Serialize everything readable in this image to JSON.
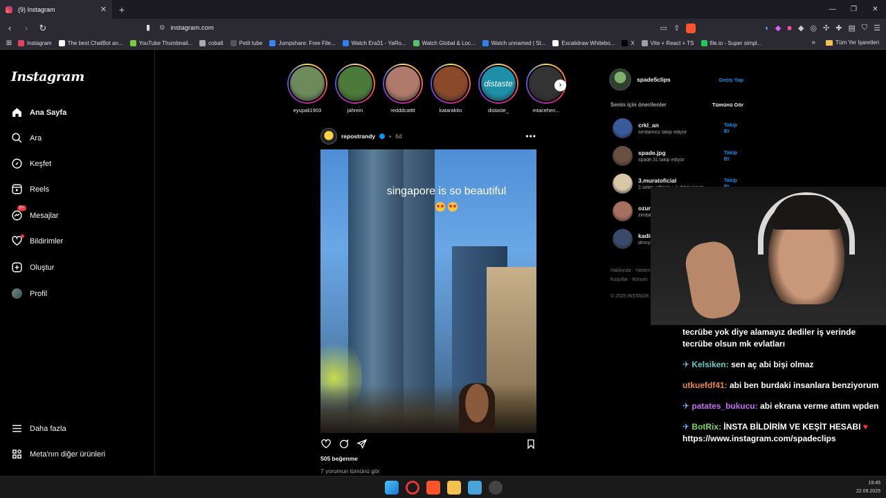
{
  "browser": {
    "tab_title": "(9) Instagram",
    "url": "instagram.com",
    "bookmarks": [
      {
        "label": "Instagram",
        "color": "#e4405f"
      },
      {
        "label": "The best ChatBot an...",
        "color": "#ffffff"
      },
      {
        "label": "YouTube Thumbnail...",
        "color": "#7ac943"
      },
      {
        "label": "cobalt",
        "color": "#aaaaaa"
      },
      {
        "label": "Petit tube",
        "color": "#555555"
      },
      {
        "label": "Jumpshare: Free File...",
        "color": "#3b82f6"
      },
      {
        "label": "Watch Era31 - YaRo...",
        "color": "#2f80ed"
      },
      {
        "label": "Watch Global & Loc...",
        "color": "#56c271"
      },
      {
        "label": "Watch unnamed | St...",
        "color": "#2f80ed"
      },
      {
        "label": "Excalidraw Whitebo...",
        "color": "#ffffff"
      },
      {
        "label": "X",
        "color": "#000000"
      },
      {
        "label": "Vite + React + TS",
        "color": "#9aa0a6"
      },
      {
        "label": "file.io - Super simpl...",
        "color": "#22c55e"
      }
    ],
    "bookmarks_all": "Tüm Yer İşaretleri"
  },
  "sidebar": {
    "logo": "Instagram",
    "items": [
      {
        "label": "Ana Sayfa",
        "icon": "home-icon"
      },
      {
        "label": "Ara",
        "icon": "search-icon"
      },
      {
        "label": "Keşfet",
        "icon": "compass-icon"
      },
      {
        "label": "Reels",
        "icon": "reels-icon"
      },
      {
        "label": "Mesajlar",
        "icon": "messenger-icon",
        "badge": "9+"
      },
      {
        "label": "Bildirimler",
        "icon": "heart-icon"
      },
      {
        "label": "Oluştur",
        "icon": "plus-icon"
      },
      {
        "label": "Profil",
        "icon": "avatar"
      }
    ],
    "more": "Daha fazla",
    "meta": "Meta'nın diğer ürünleri"
  },
  "stories": [
    {
      "name": "eyupali1903",
      "color": "#6d8a5a"
    },
    {
      "name": "jahrein",
      "color": "#4c7a3a"
    },
    {
      "name": "redddcatttt",
      "color": "#b07a6a"
    },
    {
      "name": "katarakito",
      "color": "#8a4a2a"
    },
    {
      "name": "distaste_",
      "color": "#1e8fa8",
      "text": "distaste"
    },
    {
      "name": "mtacehen...",
      "color": "#333333"
    }
  ],
  "post": {
    "username": "repostrandy",
    "time": "6d",
    "overlay_text": "singapore is so beautiful",
    "likes": "505 beğenme",
    "comments_link": "7 yorumun tümünü gör"
  },
  "right": {
    "me_username": "spade5clips",
    "switch": "Geçiş Yap",
    "suggestions_title": "Senin için önerilenler",
    "see_all": "Tümünü Gör",
    "follow_label": "Takip Et",
    "suggestions": [
      {
        "user": "crkl_an",
        "sub": "serdarincc takip ediyor",
        "color": "#3a5a9a"
      },
      {
        "user": "spade.jpg",
        "sub": "spade.31 takip ediyor",
        "color": "#6a5040"
      },
      {
        "user": "3.muratoficial",
        "sub": "2.selim_official + 1 diğer kişi ta...",
        "color": "#d8c8a8"
      },
      {
        "user": "ozurlukedi17",
        "sub": "zimbabwelifatih takip ediyor",
        "color": "#a87060"
      },
      {
        "user": "kadirlcnn",
        "sub": "dmnysnn takip ediyor",
        "color": "#3a4a6a"
      }
    ],
    "footer_line1": "Hakkında · Yardım · ... · API · İş Fı...",
    "footer_line2": "Koşullar · Konum · ... · eta Ver...",
    "footer_line3": "© 2025 INSTAGR..."
  },
  "chat": {
    "messages": [
      {
        "user": "",
        "text": "tecrübe yok diye alamayız dediler iş verinde tecrübe olsun mk evlatları"
      },
      {
        "user": "Kelsiken:",
        "text": " sen aç abi bişi olmaz"
      },
      {
        "user": "utkuefdf41:",
        "text": " abi ben burdaki insanlara benziyorum"
      },
      {
        "user": "patates_bukucu:",
        "text": " abi ekrana verme attım wpden"
      },
      {
        "user": "BotRix:",
        "text": " İNSTA BİLDİRİM VE KEŞİT HESABI",
        "link": "https://www.instagram.com/spadeclips"
      }
    ]
  },
  "taskbar": {
    "time": "19:45",
    "date": "22.09.2025"
  }
}
